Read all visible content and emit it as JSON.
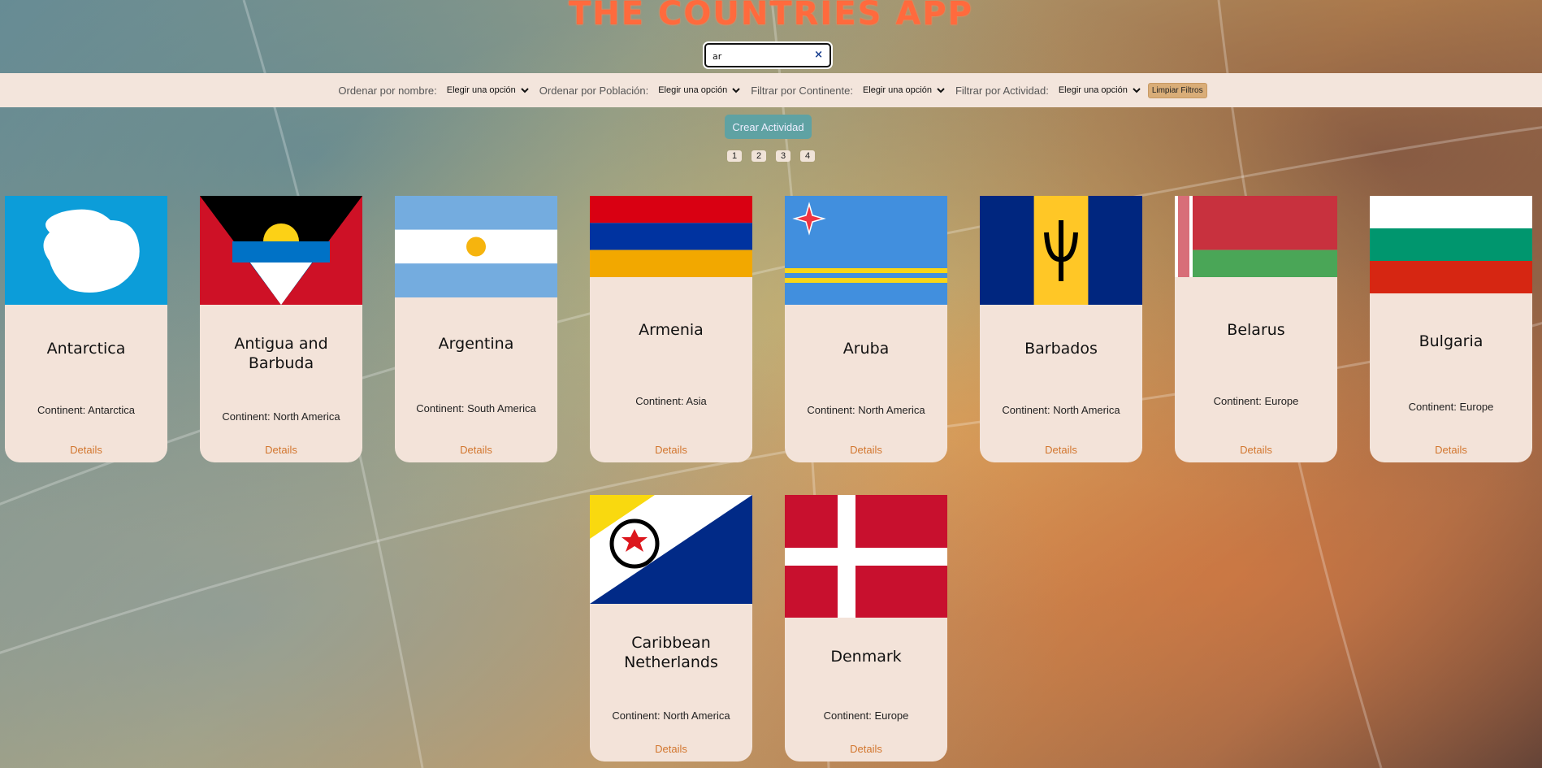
{
  "header": {
    "title": "THE COUNTRIES APP"
  },
  "search": {
    "value": "ar",
    "clear_icon": "×"
  },
  "filters": {
    "sort_name_label": "Ordenar por nombre:",
    "sort_population_label": "Ordenar por Población:",
    "continent_label": "Filtrar por Continente:",
    "activity_label": "Filtrar por Actividad:",
    "option_default": "Elegir una opción",
    "clear_label": "Limpiar Filtros"
  },
  "create_activity_label": "Crear Actividad",
  "pagination": [
    "1",
    "2",
    "3",
    "4"
  ],
  "details_label": "Details",
  "countries": [
    {
      "name": "Antarctica",
      "continent": "Continent: Antarctica"
    },
    {
      "name": "Antigua and Barbuda",
      "continent": "Continent: North America"
    },
    {
      "name": "Argentina",
      "continent": "Continent: South America"
    },
    {
      "name": "Armenia",
      "continent": "Continent: Asia"
    },
    {
      "name": "Aruba",
      "continent": "Continent: North America"
    },
    {
      "name": "Barbados",
      "continent": "Continent: North America"
    },
    {
      "name": "Belarus",
      "continent": "Continent: Europe"
    },
    {
      "name": "Bulgaria",
      "continent": "Continent: Europe"
    },
    {
      "name": "Caribbean Netherlands",
      "continent": "Continent: North America"
    },
    {
      "name": "Denmark",
      "continent": "Continent: Europe"
    }
  ],
  "colors": {
    "title": "#ff6a3d",
    "card_bg": "#f3e3d9",
    "details_link": "#d2762e",
    "create_button": "#5fa2a3"
  }
}
